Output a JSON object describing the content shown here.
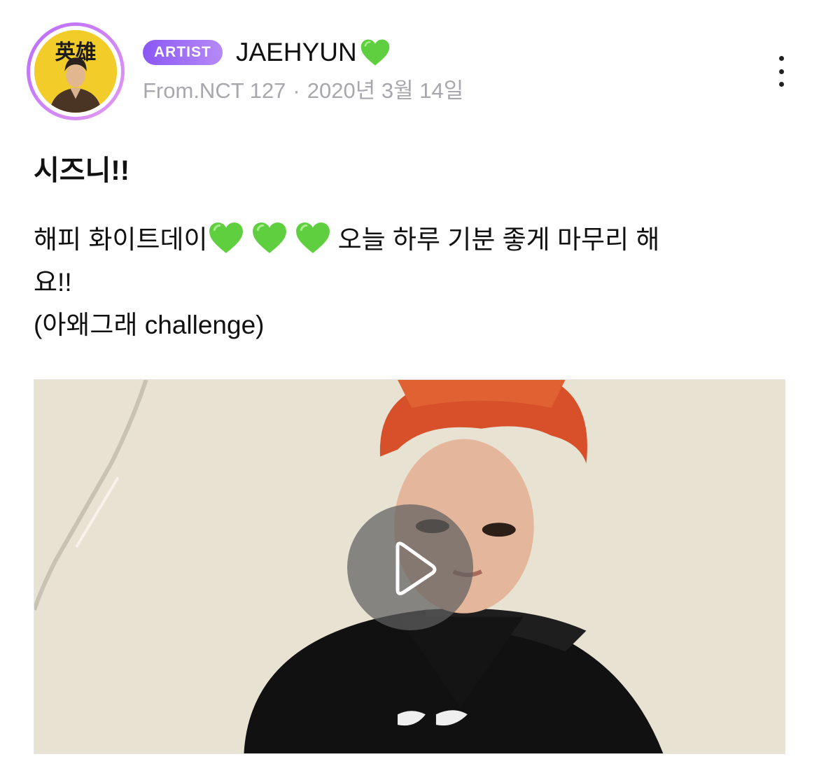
{
  "author": {
    "badge_label": "ARTIST",
    "name": "JAEHYUN",
    "name_emoji": "green-heart-icon",
    "source": "From.NCT 127",
    "separator": "·",
    "date": "2020년 3월 14일",
    "avatar_text": "英雄"
  },
  "post": {
    "title": "시즈니!!",
    "body_line1_start": "해피 화이트데이",
    "inline_hearts": [
      "green-heart-icon",
      "green-heart-icon",
      "green-heart-icon"
    ],
    "body_line1_end": "오늘 하루 기분 좋게 마무리 해",
    "body_line2": "요!!",
    "body_line3": "(아왜그래 challenge)"
  },
  "video": {
    "play_icon": "play-icon"
  },
  "menu": {
    "icon": "more-vertical-icon"
  },
  "colors": {
    "badge_start": "#8b57f5",
    "badge_end": "#b68af7",
    "heart": "#5fcf3f",
    "meta_text": "#a7a7ad",
    "avatar_bg": "#f2cd2a"
  }
}
